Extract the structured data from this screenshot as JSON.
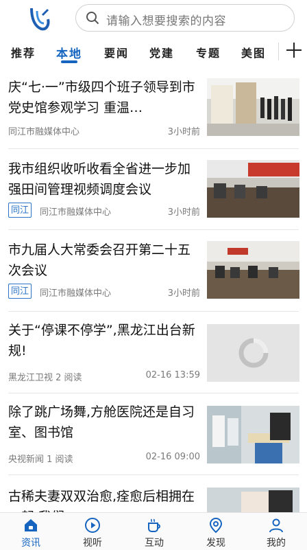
{
  "search": {
    "placeholder": "请输入想要搜索的内容"
  },
  "tabs": [
    {
      "label": "推荐"
    },
    {
      "label": "本地"
    },
    {
      "label": "要闻"
    },
    {
      "label": "党建"
    },
    {
      "label": "专题"
    },
    {
      "label": "美图"
    }
  ],
  "news": [
    {
      "title": "庆“七·一”市级四个班子领导到市党史馆参观学习 重温…",
      "tag": "",
      "source": "同江市融媒体中心",
      "time": "3小时前"
    },
    {
      "title": "我市组织收听收看全省进一步加强田间管理视频调度会议",
      "tag": "同江",
      "source": "同江市融媒体中心",
      "time": "3小时前"
    },
    {
      "title": "市九届人大常委会召开第二十五次会议",
      "tag": "同江",
      "source": "同江市融媒体中心",
      "time": "3小时前"
    },
    {
      "title": "关于“停课不停学”,黑龙江出台新规!",
      "tag": "",
      "source": "黑龙江卫视  2 阅读",
      "time": "02-16 13:59"
    },
    {
      "title": "除了跳广场舞,方舱医院还是自习室、图书馆",
      "tag": "",
      "source": "央视新闻  1 阅读",
      "time": "02-16 09:00"
    },
    {
      "title": "古稀夫妻双双治愈,痊愈后相拥在一起 我们…",
      "tag": "",
      "source": "",
      "time": ""
    }
  ],
  "bottom_nav": [
    {
      "label": "资讯",
      "icon": "home-icon"
    },
    {
      "label": "视听",
      "icon": "play-icon"
    },
    {
      "label": "互动",
      "icon": "cup-icon"
    },
    {
      "label": "发现",
      "icon": "location-icon"
    },
    {
      "label": "我的",
      "icon": "user-icon"
    }
  ],
  "colors": {
    "accent": "#1565c0",
    "tag": "#2a73c7"
  }
}
